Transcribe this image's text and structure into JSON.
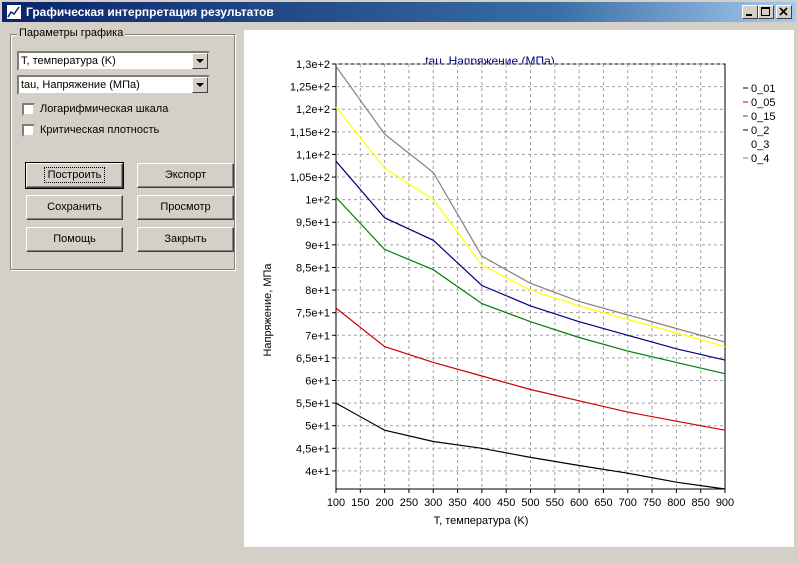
{
  "window": {
    "title": "Графическая интерпретация результатов",
    "colors": {
      "titlebar": "#0a246a",
      "face": "#d4d0c8"
    }
  },
  "params": {
    "group_label": "Параметры графика",
    "x_param": "T, температура (K)",
    "y_param": "tau, Напряжение (МПа)",
    "log_scale_label": "Логарифмическая шкала",
    "log_scale_checked": false,
    "critical_density_label": "Критическая плотность",
    "critical_density_checked": false
  },
  "buttons": {
    "build": "Построить",
    "export": "Экспорт",
    "save": "Сохранить",
    "view": "Просмотр",
    "help": "Помощь",
    "close": "Закрыть"
  },
  "chart_data": {
    "type": "line",
    "title": "tau, Напряжение (МПа)",
    "xlabel": "T, температура (K)",
    "ylabel": "Напряжение, МПа",
    "xlim": [
      100,
      900
    ],
    "ylim": [
      36,
      130
    ],
    "grid": true,
    "legend_position": "right",
    "x_ticks": [
      100,
      150,
      200,
      250,
      300,
      350,
      400,
      450,
      500,
      550,
      600,
      650,
      700,
      750,
      800,
      850,
      900
    ],
    "x_tick_labels": [
      "100",
      "150",
      "200",
      "250",
      "300",
      "350",
      "400",
      "450",
      "500",
      "550",
      "600",
      "650",
      "700",
      "750",
      "800",
      "850",
      "900"
    ],
    "y_ticks": [
      40,
      45,
      50,
      55,
      60,
      65,
      70,
      75,
      80,
      85,
      90,
      95,
      100,
      105,
      110,
      115,
      120,
      125,
      130
    ],
    "y_tick_labels": [
      "4e+1",
      "4,5e+1",
      "5e+1",
      "5,5e+1",
      "6e+1",
      "6,5e+1",
      "7e+1",
      "7,5e+1",
      "8e+1",
      "8,5e+1",
      "9e+1",
      "9,5e+1",
      "1e+2",
      "1,05e+2",
      "1,1e+2",
      "1,15e+2",
      "1,2e+2",
      "1,25e+2",
      "1,3e+2"
    ],
    "series": [
      {
        "name": "0_01",
        "color": "#000000",
        "x": [
          100,
          200,
          300,
          400,
          500,
          600,
          700,
          800,
          900
        ],
        "y": [
          55,
          49,
          46.5,
          45,
          43,
          41.2,
          39.5,
          37.5,
          35.5
        ]
      },
      {
        "name": "0_05",
        "color": "#cc0000",
        "x": [
          100,
          200,
          300,
          400,
          500,
          600,
          700,
          800,
          900
        ],
        "y": [
          76,
          67.5,
          64,
          61,
          58,
          55.5,
          53,
          51,
          49
        ]
      },
      {
        "name": "0_15",
        "color": "#008000",
        "x": [
          100,
          200,
          300,
          400,
          500,
          600,
          700,
          800,
          900
        ],
        "y": [
          100.5,
          89,
          84.5,
          77,
          73,
          69.5,
          66.5,
          64,
          61.5
        ]
      },
      {
        "name": "0_2",
        "color": "#000080",
        "x": [
          100,
          200,
          300,
          400,
          500,
          600,
          700,
          800,
          900
        ],
        "y": [
          108.5,
          96,
          91,
          81,
          76.5,
          73,
          70,
          67,
          64.5
        ]
      },
      {
        "name": "0_3",
        "color": "#ffff00",
        "x": [
          100,
          200,
          300,
          400,
          500,
          600,
          700,
          800,
          900
        ],
        "y": [
          120.5,
          107,
          100,
          85.5,
          80,
          76.5,
          73.5,
          70.5,
          67.5
        ]
      },
      {
        "name": "0_4",
        "color": "#808080",
        "x": [
          100,
          200,
          300,
          400,
          500,
          600,
          700,
          800,
          900
        ],
        "y": [
          129.5,
          114.5,
          106,
          87.5,
          81.5,
          77.5,
          74.5,
          71.5,
          68.5
        ]
      }
    ]
  }
}
